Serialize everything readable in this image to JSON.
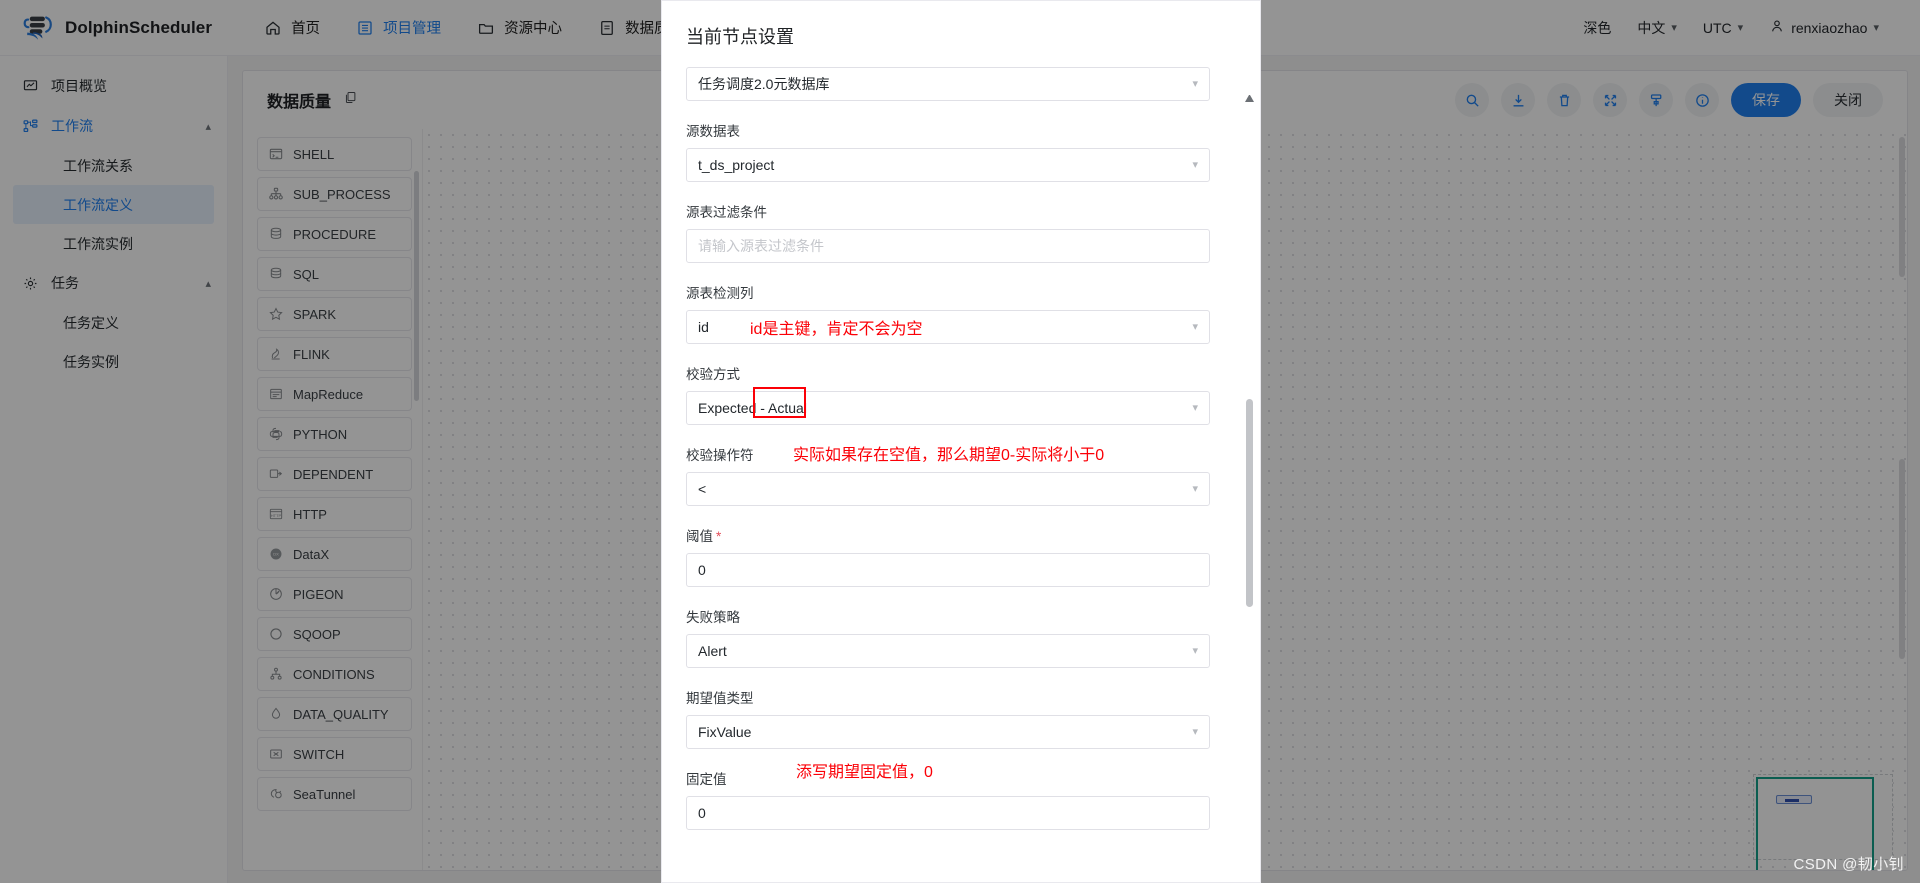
{
  "app": {
    "brand": "DolphinScheduler",
    "nav": [
      {
        "label": "首页",
        "icon": "home-icon",
        "active": false
      },
      {
        "label": "项目管理",
        "icon": "project-icon",
        "active": true
      },
      {
        "label": "资源中心",
        "icon": "folder-icon",
        "active": false
      },
      {
        "label": "数据质量",
        "icon": "data-quality-icon",
        "active": false
      }
    ],
    "top_right": {
      "theme": "深色",
      "language": "中文",
      "timezone": "UTC",
      "user": "renxiaozhao"
    }
  },
  "sidebar": {
    "items": [
      {
        "label": "项目概览",
        "icon": "overview-icon",
        "type": "row"
      },
      {
        "label": "工作流",
        "icon": "workflow-icon",
        "type": "group",
        "expanded": true
      },
      {
        "label": "工作流关系",
        "type": "sub",
        "active": false
      },
      {
        "label": "工作流定义",
        "type": "sub",
        "active": true
      },
      {
        "label": "工作流实例",
        "type": "sub",
        "active": false
      },
      {
        "label": "任务",
        "icon": "gear-icon",
        "type": "group",
        "expanded": true
      },
      {
        "label": "任务定义",
        "type": "sub",
        "active": false
      },
      {
        "label": "任务实例",
        "type": "sub",
        "active": false
      }
    ]
  },
  "editor": {
    "title": "数据质量",
    "copy_icon": "copy-icon",
    "tools": [
      {
        "name": "search-icon"
      },
      {
        "name": "download-icon"
      },
      {
        "name": "delete-icon"
      },
      {
        "name": "fullscreen-icon"
      },
      {
        "name": "format-icon"
      },
      {
        "name": "info-icon"
      }
    ],
    "save_label": "保存",
    "close_label": "关闭"
  },
  "palette": {
    "tasks": [
      {
        "label": "SHELL",
        "icon": "shell-icon"
      },
      {
        "label": "SUB_PROCESS",
        "icon": "subprocess-icon"
      },
      {
        "label": "PROCEDURE",
        "icon": "procedure-icon"
      },
      {
        "label": "SQL",
        "icon": "sql-icon"
      },
      {
        "label": "SPARK",
        "icon": "spark-icon"
      },
      {
        "label": "FLINK",
        "icon": "flink-icon"
      },
      {
        "label": "MapReduce",
        "icon": "mapreduce-icon"
      },
      {
        "label": "PYTHON",
        "icon": "python-icon"
      },
      {
        "label": "DEPENDENT",
        "icon": "dependent-icon"
      },
      {
        "label": "HTTP",
        "icon": "http-icon"
      },
      {
        "label": "DataX",
        "icon": "datax-icon"
      },
      {
        "label": "PIGEON",
        "icon": "pigeon-icon"
      },
      {
        "label": "SQOOP",
        "icon": "sqoop-icon"
      },
      {
        "label": "CONDITIONS",
        "icon": "conditions-icon"
      },
      {
        "label": "DATA_QUALITY",
        "icon": "data-quality-icon"
      },
      {
        "label": "SWITCH",
        "icon": "switch-icon"
      },
      {
        "label": "SeaTunnel",
        "icon": "seatunnel-icon"
      }
    ]
  },
  "modal": {
    "title": "当前节点设置",
    "fields": {
      "datasource_instance": {
        "value": "任务调度2.0元数据库"
      },
      "source_table": {
        "label": "源数据表",
        "value": "t_ds_project"
      },
      "source_filter": {
        "label": "源表过滤条件",
        "value": "",
        "placeholder": "请输入源表过滤条件"
      },
      "source_column": {
        "label": "源表检测列",
        "value": "id"
      },
      "check_method": {
        "label": "校验方式",
        "value": "Expected - Actual"
      },
      "operator": {
        "label": "校验操作符",
        "value": "<"
      },
      "threshold": {
        "label": "阈值",
        "required": true,
        "value": "0"
      },
      "failure_strategy": {
        "label": "失败策略",
        "value": "Alert"
      },
      "expected_type": {
        "label": "期望值类型",
        "value": "FixValue"
      },
      "fixed_value": {
        "label": "固定值",
        "value": "0"
      }
    },
    "annotations": [
      {
        "text": "id是主键，肯定不会为空"
      },
      {
        "text": "实际如果存在空值，那么期望0-实际将小于0"
      },
      {
        "text": "添写期望固定值，0"
      }
    ],
    "accent_red": "#fb0007"
  },
  "watermark": "CSDN @韧小钊"
}
